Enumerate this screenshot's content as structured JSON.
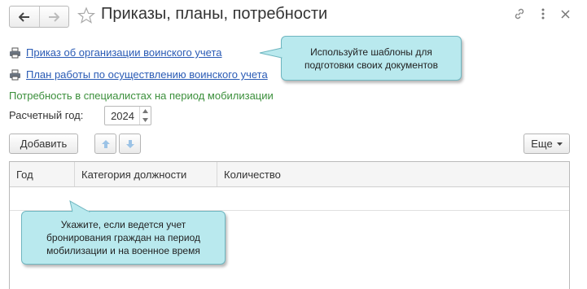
{
  "header": {
    "title": "Приказы, планы, потребности",
    "back_icon": "arrow-left-icon",
    "forward_icon": "arrow-right-icon",
    "favorite_icon": "star-icon",
    "link_icon": "link-icon",
    "more_icon": "more-vertical-icon",
    "close_icon": "close-icon"
  },
  "links": [
    {
      "label": "Приказ об организации воинского учета",
      "icon": "printer-icon"
    },
    {
      "label": "План работы по осуществлению воинского учета",
      "icon": "printer-icon"
    }
  ],
  "section": {
    "heading": "Потребность в специалистах на период мобилизации",
    "year_label": "Расчетный год:",
    "year_value": "2024"
  },
  "toolbar": {
    "add_label": "Добавить",
    "move_up_icon": "arrow-up-icon",
    "move_down_icon": "arrow-down-icon",
    "more_label": "Еще"
  },
  "table": {
    "columns": [
      "Год",
      "Категория должности",
      "Количество"
    ],
    "rows": []
  },
  "tooltips": {
    "templates": "Используйте шаблоны для подготовки своих документов",
    "booking": "Укажите, если ведется учет бронирования граждан на период мобилизации и на военное время"
  },
  "colors": {
    "link": "#2a5bb5",
    "heading_green": "#3b8f3b",
    "tooltip_bg": "#b9e9ee",
    "tooltip_border": "#6fb6c0",
    "disabled_arrow": "#9cc3e6"
  }
}
